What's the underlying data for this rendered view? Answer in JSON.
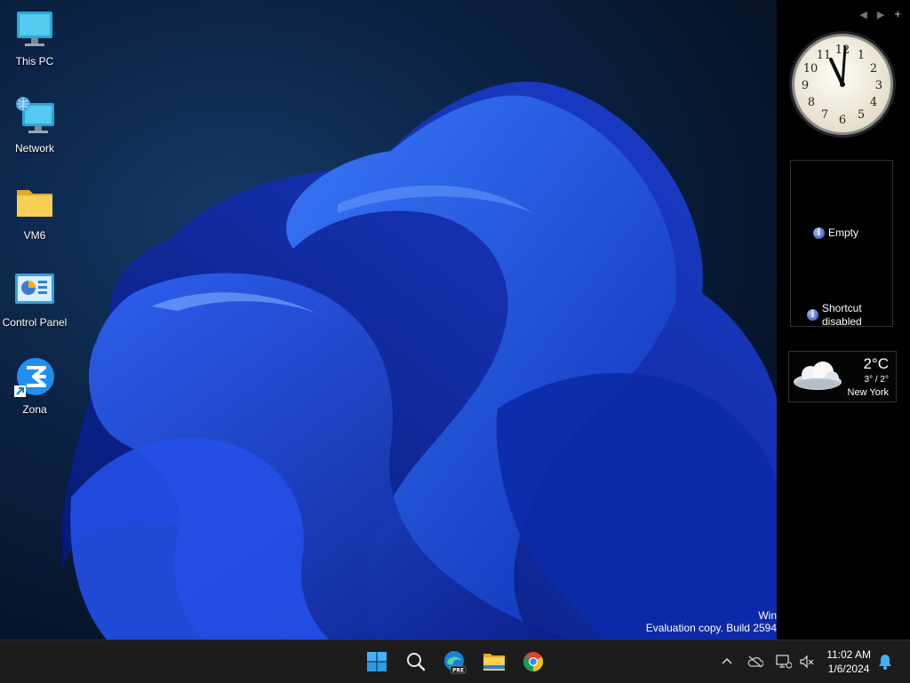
{
  "desktop": {
    "icons": [
      {
        "label": "This PC",
        "icon": "computer-icon"
      },
      {
        "label": "Network",
        "icon": "network-icon"
      },
      {
        "label": "VM6",
        "icon": "folder-icon"
      },
      {
        "label": "Control Panel",
        "icon": "control-panel-icon"
      },
      {
        "label": "Zona",
        "icon": "zona-shortcut-icon"
      }
    ],
    "watermark": {
      "line1": "Win",
      "line2": "Evaluation copy. Build 2594"
    }
  },
  "sidebar": {
    "controls": {
      "prev": "◀",
      "next": "▶",
      "add": "+"
    },
    "clock": {
      "time": "11:02"
    },
    "slideshow": {
      "empty_label": "Empty",
      "shortcut_label_1": "Shortcut",
      "shortcut_label_2": "disabled"
    },
    "weather": {
      "temperature": "2°C",
      "range": "3° / 2°",
      "city": "New York"
    }
  },
  "taskbar": {
    "apps": [
      "start-icon",
      "search-icon",
      "edge-preview-icon",
      "file-explorer-icon",
      "chrome-icon"
    ],
    "edge_badge": "PRE",
    "time": "11:02 AM",
    "date": "1/6/2024",
    "tray": [
      "chevron-up-icon",
      "cloud-offline-icon",
      "network-status-icon",
      "volume-muted-icon",
      "notification-bell-icon"
    ]
  }
}
